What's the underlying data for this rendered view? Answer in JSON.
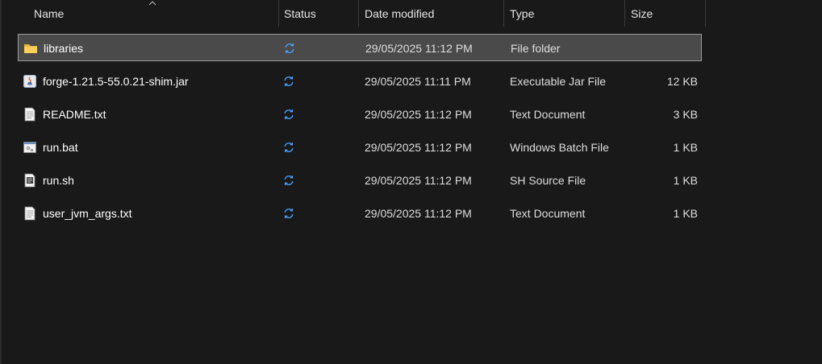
{
  "columns": {
    "name": "Name",
    "status": "Status",
    "date_modified": "Date modified",
    "type": "Type",
    "size": "Size"
  },
  "sort": {
    "column": "Name",
    "direction": "ascending"
  },
  "files": [
    {
      "name": "libraries",
      "icon": "folder-icon",
      "status_icon": "sync-icon",
      "date": "29/05/2025 11:12 PM",
      "type": "File folder",
      "size": "",
      "selected": true
    },
    {
      "name": "forge-1.21.5-55.0.21-shim.jar",
      "icon": "java-jar-icon",
      "status_icon": "sync-icon",
      "date": "29/05/2025 11:11 PM",
      "type": "Executable Jar File",
      "size": "12 KB",
      "selected": false
    },
    {
      "name": "README.txt",
      "icon": "text-document-icon",
      "status_icon": "sync-icon",
      "date": "29/05/2025 11:12 PM",
      "type": "Text Document",
      "size": "3 KB",
      "selected": false
    },
    {
      "name": "run.bat",
      "icon": "batch-file-icon",
      "status_icon": "sync-icon",
      "date": "29/05/2025 11:12 PM",
      "type": "Windows Batch File",
      "size": "1 KB",
      "selected": false
    },
    {
      "name": "run.sh",
      "icon": "sh-source-icon",
      "status_icon": "sync-icon",
      "date": "29/05/2025 11:12 PM",
      "type": "SH Source File",
      "size": "1 KB",
      "selected": false
    },
    {
      "name": "user_jvm_args.txt",
      "icon": "text-document-icon",
      "status_icon": "sync-icon",
      "date": "29/05/2025 11:12 PM",
      "type": "Text Document",
      "size": "1 KB",
      "selected": false
    }
  ],
  "colors": {
    "background": "#191919",
    "selection": "#4a4a4a",
    "selection_border": "#9a9a9a",
    "sync_icon": "#4aa3ff",
    "folder": "#f2c94c"
  }
}
